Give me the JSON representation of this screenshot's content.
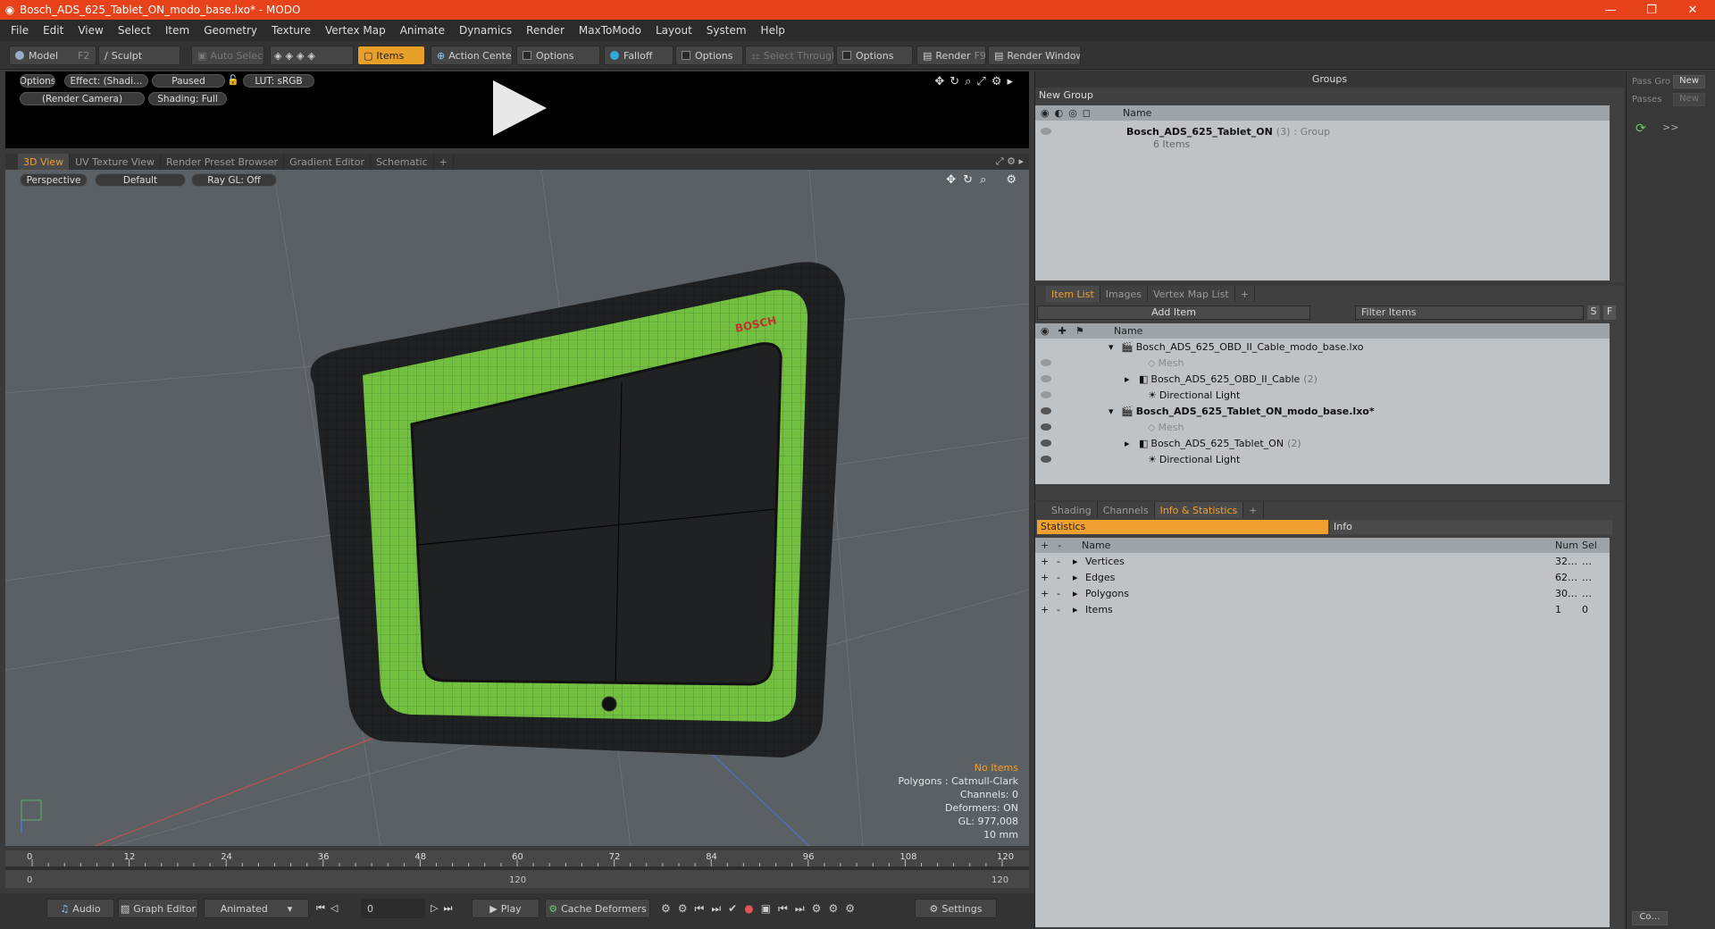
{
  "window": {
    "title": "Bosch_ADS_625_Tablet_ON_modo_base.lxo* - MODO",
    "min": "—",
    "max": "❐",
    "close": "✕"
  },
  "menu": [
    "File",
    "Edit",
    "View",
    "Select",
    "Item",
    "Geometry",
    "Texture",
    "Vertex Map",
    "Animate",
    "Dynamics",
    "Render",
    "MaxToModo",
    "Layout",
    "System",
    "Help"
  ],
  "toolbar": {
    "model": "Model",
    "model_key": "F2",
    "sculpt": "Sculpt",
    "auto_select": "Auto Select",
    "items": "Items",
    "action_center": "Action Center",
    "options1": "Options",
    "falloff": "Falloff",
    "options2": "Options",
    "select_through": "Select Through",
    "options3": "Options",
    "render": "Render",
    "render_key": "F9",
    "render_window": "Render Window"
  },
  "preview": {
    "options": "Options",
    "effect": "Effect: (Shadi…",
    "paused": "Paused",
    "lut": "LUT: sRGB",
    "camera": "(Render Camera)",
    "shading": "Shading: Full"
  },
  "view_tabs": [
    "3D View",
    "UV Texture View",
    "Render Preset Browser",
    "Gradient Editor",
    "Schematic",
    "+"
  ],
  "viewport": {
    "perspective": "Perspective",
    "default": "Default",
    "raygl": "Ray GL: Off",
    "brand": "BOSCH",
    "info": {
      "no_items": "No Items",
      "polygons": "Polygons : Catmull-Clark",
      "channels": "Channels: 0",
      "deformers": "Deformers: ON",
      "gl": "GL: 977,008",
      "scale": "10 mm"
    }
  },
  "timeline": {
    "ticks": [
      "0",
      "12",
      "24",
      "36",
      "48",
      "60",
      "72",
      "84",
      "96",
      "108",
      "120"
    ],
    "start": "0",
    "mid": "120",
    "end": "120"
  },
  "bottombar": {
    "audio": "Audio",
    "graph_editor": "Graph Editor",
    "animated": "Animated",
    "frame": "0",
    "play": "Play",
    "cache": "Cache Deformers",
    "settings": "Settings"
  },
  "groups": {
    "title": "Groups",
    "new_group": "New Group",
    "col_name": "Name",
    "item_name": "Bosch_ADS_625_Tablet_ON",
    "item_count": "(3)",
    "item_type": ": Group",
    "item_sub": "6 Items"
  },
  "pass": {
    "pass_group": "Pass Gro",
    "passes": "Passes",
    "new1": "New",
    "new2": "New",
    "more": ">>"
  },
  "item_list": {
    "tabs": [
      "Item List",
      "Images",
      "Vertex Map List",
      "+"
    ],
    "add_item": "Add Item",
    "filter": "Filter Items",
    "s": "S",
    "f": "F",
    "col_name": "Name",
    "rows": [
      {
        "label": "Bosch_ADS_625_OBD_II_Cable_modo_base.lxo",
        "count": ""
      },
      {
        "label": "Mesh",
        "count": ""
      },
      {
        "label": "Bosch_ADS_625_OBD_II_Cable",
        "count": "(2)"
      },
      {
        "label": "Directional Light",
        "count": ""
      },
      {
        "label": "Bosch_ADS_625_Tablet_ON_modo_base.lxo*",
        "count": ""
      },
      {
        "label": "Mesh",
        "count": ""
      },
      {
        "label": "Bosch_ADS_625_Tablet_ON",
        "count": "(2)"
      },
      {
        "label": "Directional Light",
        "count": ""
      }
    ]
  },
  "stats": {
    "tabs": [
      "Shading",
      "Channels",
      "Info & Statistics",
      "+"
    ],
    "statistics": "Statistics",
    "info": "Info",
    "col_name": "Name",
    "col_num": "Num",
    "col_sel": "Sel",
    "rows": [
      {
        "name": "Vertices",
        "num": "32…",
        "sel": "…"
      },
      {
        "name": "Edges",
        "num": "62…",
        "sel": "…"
      },
      {
        "name": "Polygons",
        "num": "30…",
        "sel": "…"
      },
      {
        "name": "Items",
        "num": "1",
        "sel": "0"
      }
    ]
  },
  "corner": {
    "co": "Co…"
  }
}
